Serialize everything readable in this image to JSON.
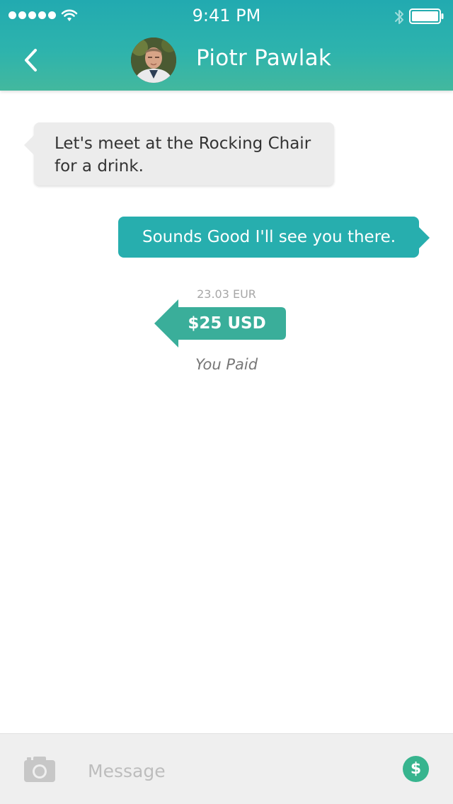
{
  "status_bar": {
    "time": "9:41 PM",
    "icons": [
      "signal-dots-icon",
      "wifi-icon",
      "bluetooth-icon",
      "battery-icon"
    ]
  },
  "header": {
    "back_icon": "chevron-left-icon",
    "contact_name": "Piotr Pawlak",
    "avatar": "contact-avatar-photo"
  },
  "messages": [
    {
      "direction": "incoming",
      "text": "Let's meet at the Rocking Chair for a drink."
    },
    {
      "direction": "outgoing",
      "text": "Sounds Good I'll see you there."
    }
  ],
  "payment": {
    "converted_amount": "23.03 EUR",
    "amount": "$25 USD",
    "status": "You Paid"
  },
  "composer": {
    "camera_icon": "camera-icon",
    "placeholder": "Message",
    "value": "",
    "pay_icon": "dollar-icon",
    "pay_symbol": "$"
  },
  "colors": {
    "header_teal": "#22aab0",
    "accent_teal": "#27aeae",
    "payment_green": "#3aae9a",
    "pay_button_green": "#37b48e",
    "incoming_bubble": "#ececec"
  }
}
